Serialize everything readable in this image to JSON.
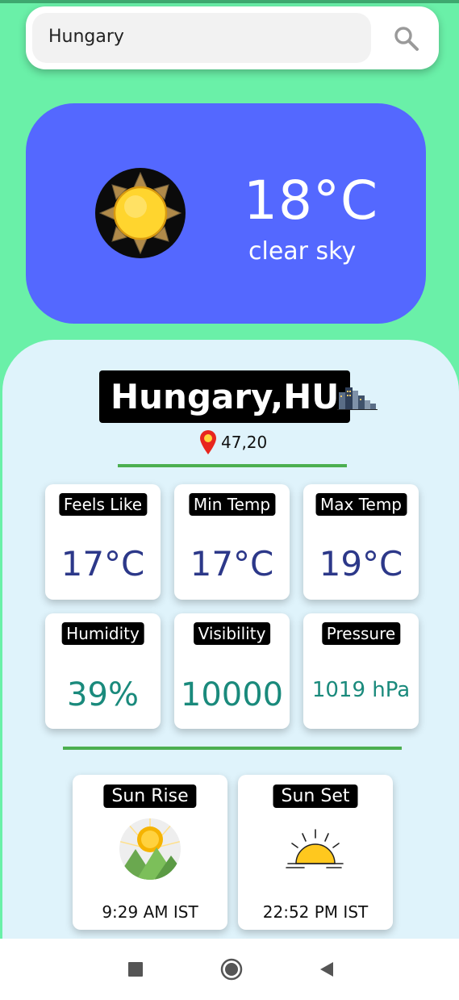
{
  "search": {
    "value": "Hungary",
    "icon": "search-icon"
  },
  "current": {
    "temperature": "18°C",
    "description": "clear sky",
    "icon": "sun-icon"
  },
  "location": {
    "name": "Hungary,HU",
    "coords": "47,20",
    "city_icon": "city-skyline-icon",
    "pin_icon": "location-pin-icon"
  },
  "stats": [
    {
      "label": "Feels Like",
      "value": "17°C"
    },
    {
      "label": "Min Temp",
      "value": "17°C"
    },
    {
      "label": "Max Temp",
      "value": "19°C"
    },
    {
      "label": "Humidity",
      "value": "39%"
    },
    {
      "label": "Visibility",
      "value": "10000"
    },
    {
      "label": "Pressure",
      "value": "1019 hPa"
    }
  ],
  "sun": {
    "rise": {
      "label": "Sun Rise",
      "time": "9:29 AM IST",
      "icon": "sunrise-icon"
    },
    "set": {
      "label": "Sun Set",
      "time": "22:52 PM IST",
      "icon": "sunset-icon"
    }
  },
  "nav": {
    "recents_icon": "square-icon",
    "home_icon": "circle-icon",
    "back_icon": "triangle-back-icon"
  },
  "colors": {
    "background": "#6af0a8",
    "hero": "#5468ff",
    "sheet": "#dff3fb",
    "accent_green": "#4caf50",
    "value_navy": "#2c3889",
    "value_teal": "#1a8a7c"
  }
}
